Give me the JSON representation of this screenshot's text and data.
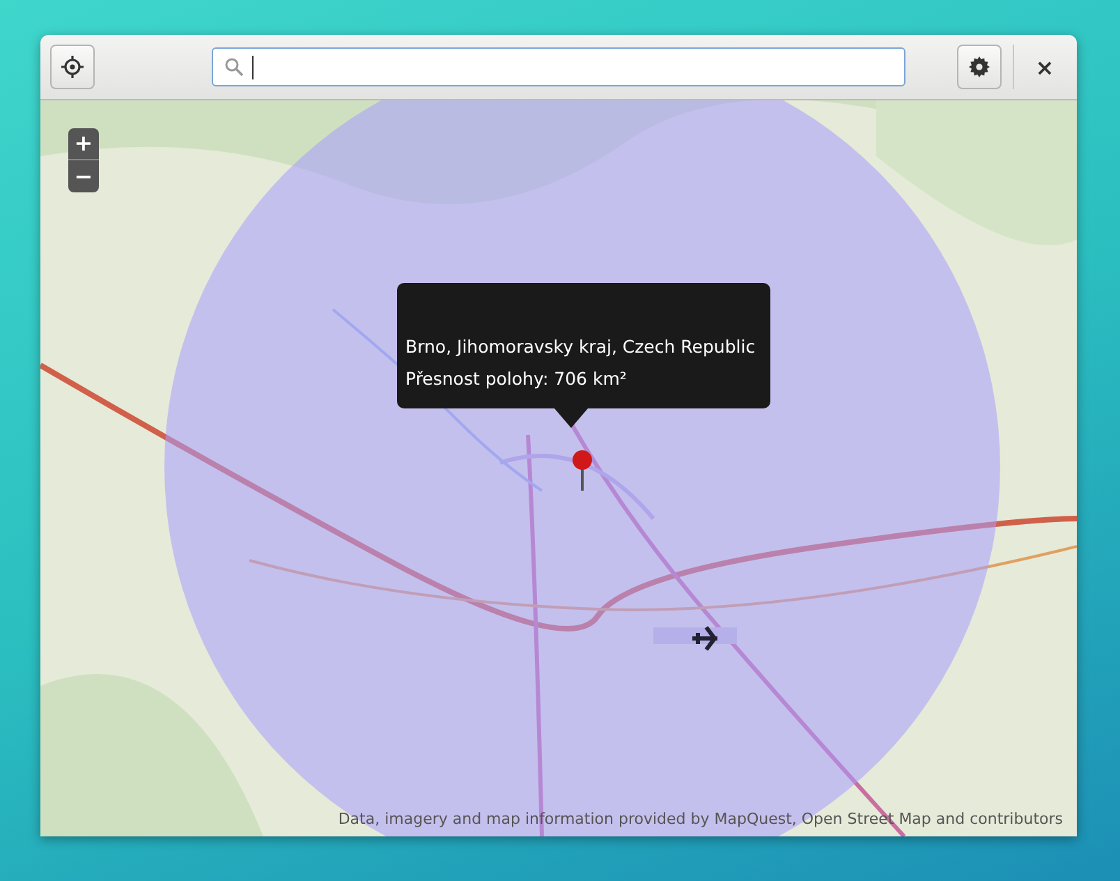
{
  "header_bar": {
    "close_label": "×"
  },
  "map": {
    "zoom_buttons": [
      "+",
      "−"
    ],
    "popup": {
      "lines": [
        "Brno, Jihomoravsky kraj, Czech Republic",
        "Přesnost polohy: 706 km²"
      ]
    },
    "attribution": "Data, imagery and map information provided by MapQuest, Open Street Map and contributors"
  }
}
